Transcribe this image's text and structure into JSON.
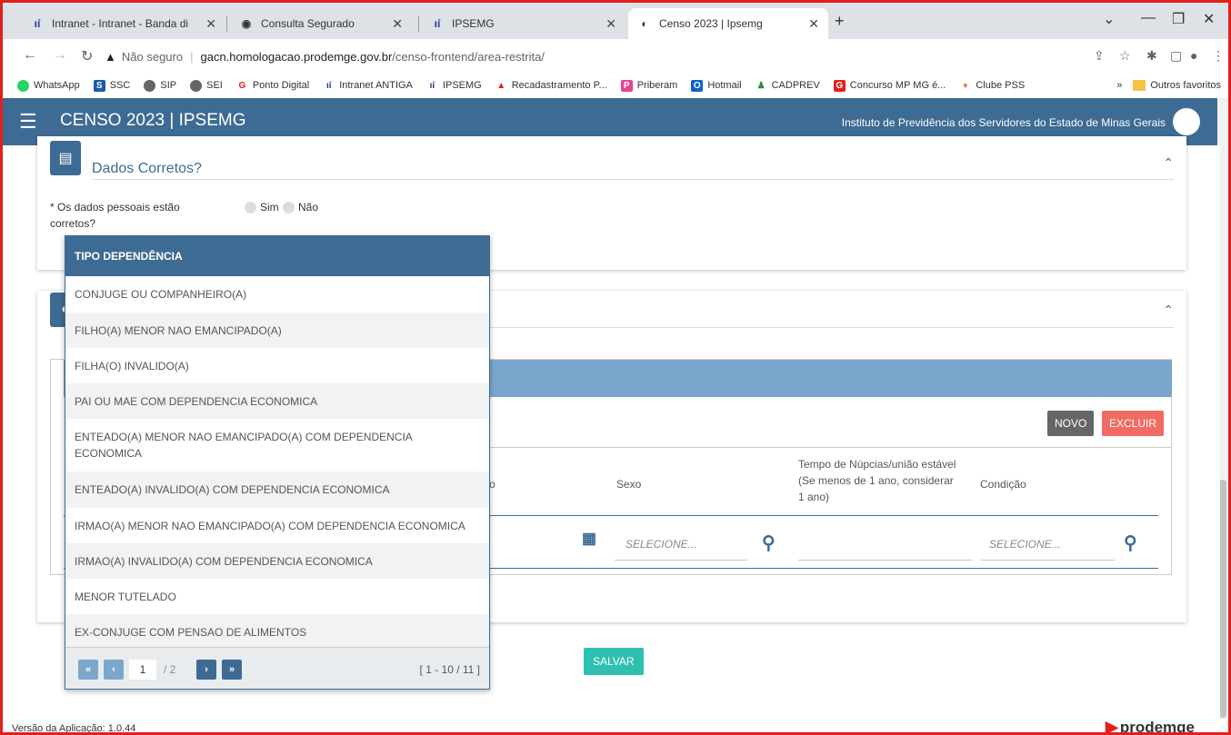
{
  "browser": {
    "tabs": [
      {
        "title": "Intranet - Intranet - Banda direita",
        "icon": "ipsemg-icon"
      },
      {
        "title": "Consulta Segurado",
        "icon": "globe-icon"
      },
      {
        "title": "IPSEMG",
        "icon": "ipsemg-icon"
      },
      {
        "title": "Censo 2023 | Ipsemg",
        "icon": "censo-icon",
        "active": true
      }
    ],
    "address": {
      "warning": "Não seguro",
      "host": "gacn.homologacao.prodemge.gov.br",
      "path": "/censo-frontend/area-restrita/"
    },
    "bookmarks": [
      "WhatsApp",
      "SSC",
      "SIP",
      "SEI",
      "Ponto Digital",
      "Intranet ANTIGA",
      "IPSEMG",
      "Recadastramento P...",
      "Priberam",
      "Hotmail",
      "CADPREV",
      "Concurso MP MG é...",
      "Clube PSS"
    ],
    "other_bookmarks": "Outros favoritos"
  },
  "app": {
    "title": "CENSO 2023 | IPSEMG",
    "institution": "Instituto de Previdência dos Servidores do Estado de Minas Gerais"
  },
  "section1": {
    "title": "Dados Corretos?",
    "question": "* Os dados pessoais estão corretos?",
    "options": [
      "Sim",
      "Não"
    ]
  },
  "section2": {
    "buttons": {
      "new": "NOVO",
      "delete": "EXCLUIR"
    },
    "columns": {
      "partial": "o",
      "sex": "Sexo",
      "time": "Tempo de Núpcias/união estável (Se menos de 1 ano, considerar 1 ano)",
      "condition": "Condição"
    },
    "select_placeholder": "SELECIONE..."
  },
  "save_label": "SALVAR",
  "footer": {
    "version": "Versão da Aplicação: 1.0.44",
    "brand": "prodemge"
  },
  "dropdown": {
    "header": "TIPO DEPENDÊNCIA",
    "items": [
      "CONJUGE OU COMPANHEIRO(A)",
      "FILHO(A) MENOR NAO EMANCIPADO(A)",
      "FILHA(O) INVALIDO(A)",
      "PAI OU MAE COM DEPENDENCIA ECONOMICA",
      "ENTEADO(A) MENOR NAO EMANCIPADO(A) COM DEPENDENCIA ECONOMICA",
      "ENTEADO(A) INVALIDO(A) COM DEPENDENCIA ECONOMICA",
      "IRMAO(A) MENOR NAO EMANCIPADO(A) COM DEPENDENCIA ECONOMICA",
      "IRMAO(A) INVALIDO(A) COM DEPENDENCIA ECONOMICA",
      "MENOR TUTELADO",
      "EX-CONJUGE COM PENSAO DE ALIMENTOS"
    ],
    "pagination": {
      "current_page": "1",
      "total_pages": "/ 2",
      "range": "[ 1 - 10 / 11 ]"
    }
  }
}
